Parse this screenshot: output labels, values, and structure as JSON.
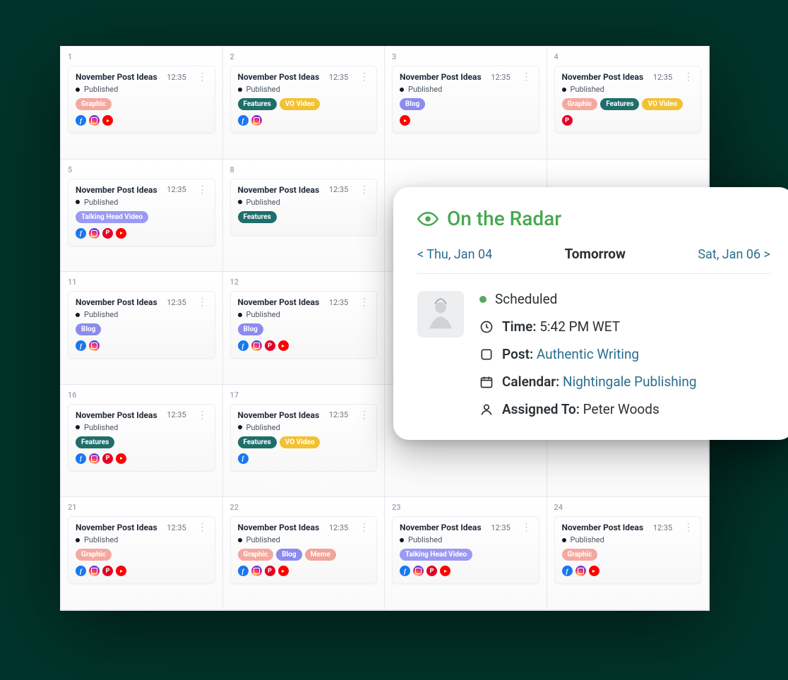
{
  "card_defaults": {
    "title": "November Post Ideas",
    "time": "12:35",
    "status": "Published"
  },
  "tag_labels": {
    "graphic": "Graphic",
    "features": "Features",
    "vo": "VO Video",
    "blog": "Blog",
    "thv": "Talking Head Video",
    "meme": "Meme"
  },
  "icon_names": {
    "fb": "facebook",
    "ig": "instagram",
    "pt": "pinterest",
    "yt": "youtube"
  },
  "cells": [
    {
      "day": "1",
      "tags": [
        "graphic"
      ],
      "icons": [
        "fb",
        "ig",
        "yt"
      ]
    },
    {
      "day": "2",
      "tags": [
        "features",
        "vo"
      ],
      "icons": [
        "fb",
        "ig"
      ]
    },
    {
      "day": "3",
      "tags": [
        "blog"
      ],
      "icons": [
        "yt"
      ]
    },
    {
      "day": "4",
      "tags": [
        "graphic",
        "features",
        "vo"
      ],
      "icons": [
        "pt"
      ]
    },
    {
      "day": "5",
      "tags": [
        "thv"
      ],
      "icons": [
        "fb",
        "ig",
        "pt",
        "yt"
      ]
    },
    {
      "day": "8",
      "tags": [
        "features"
      ],
      "icons": []
    },
    {
      "day": "",
      "hidden": true
    },
    {
      "day": "",
      "hidden": true
    },
    {
      "day": "11",
      "tags": [
        "blog"
      ],
      "icons": [
        "fb",
        "ig"
      ]
    },
    {
      "day": "12",
      "tags": [
        "blog"
      ],
      "icons": [
        "fb",
        "ig",
        "pt",
        "yt"
      ]
    },
    {
      "day": "",
      "hidden": true
    },
    {
      "day": "",
      "hidden": true
    },
    {
      "day": "16",
      "tags": [
        "features"
      ],
      "icons": [
        "fb",
        "ig",
        "pt",
        "yt"
      ]
    },
    {
      "day": "17",
      "tags": [
        "features",
        "vo"
      ],
      "icons": [
        "fb"
      ]
    },
    {
      "day": "",
      "hidden": true
    },
    {
      "day": "",
      "hidden": true
    },
    {
      "day": "21",
      "tags": [
        "graphic"
      ],
      "icons": [
        "fb",
        "ig",
        "pt",
        "yt"
      ]
    },
    {
      "day": "22",
      "tags": [
        "graphic",
        "blog",
        "meme"
      ],
      "icons": [
        "fb",
        "ig",
        "pt",
        "yt"
      ]
    },
    {
      "day": "23",
      "tags": [
        "thv"
      ],
      "icons": [
        "fb",
        "ig",
        "pt",
        "yt"
      ]
    },
    {
      "day": "24",
      "tags": [
        "graphic"
      ],
      "icons": [
        "fb",
        "ig",
        "yt"
      ]
    }
  ],
  "radar": {
    "title": "On the Radar",
    "prev": "< Thu, Jan 04",
    "center": "Tomorrow",
    "next": "Sat, Jan 06 >",
    "status": "Scheduled",
    "time_label": "Time:",
    "time_value": "5:42 PM WET",
    "post_label": "Post:",
    "post_value": "Authentic Writing",
    "calendar_label": "Calendar:",
    "calendar_value": "Nightingale Publishing",
    "assigned_label": "Assigned To:",
    "assigned_value": "Peter Woods"
  }
}
